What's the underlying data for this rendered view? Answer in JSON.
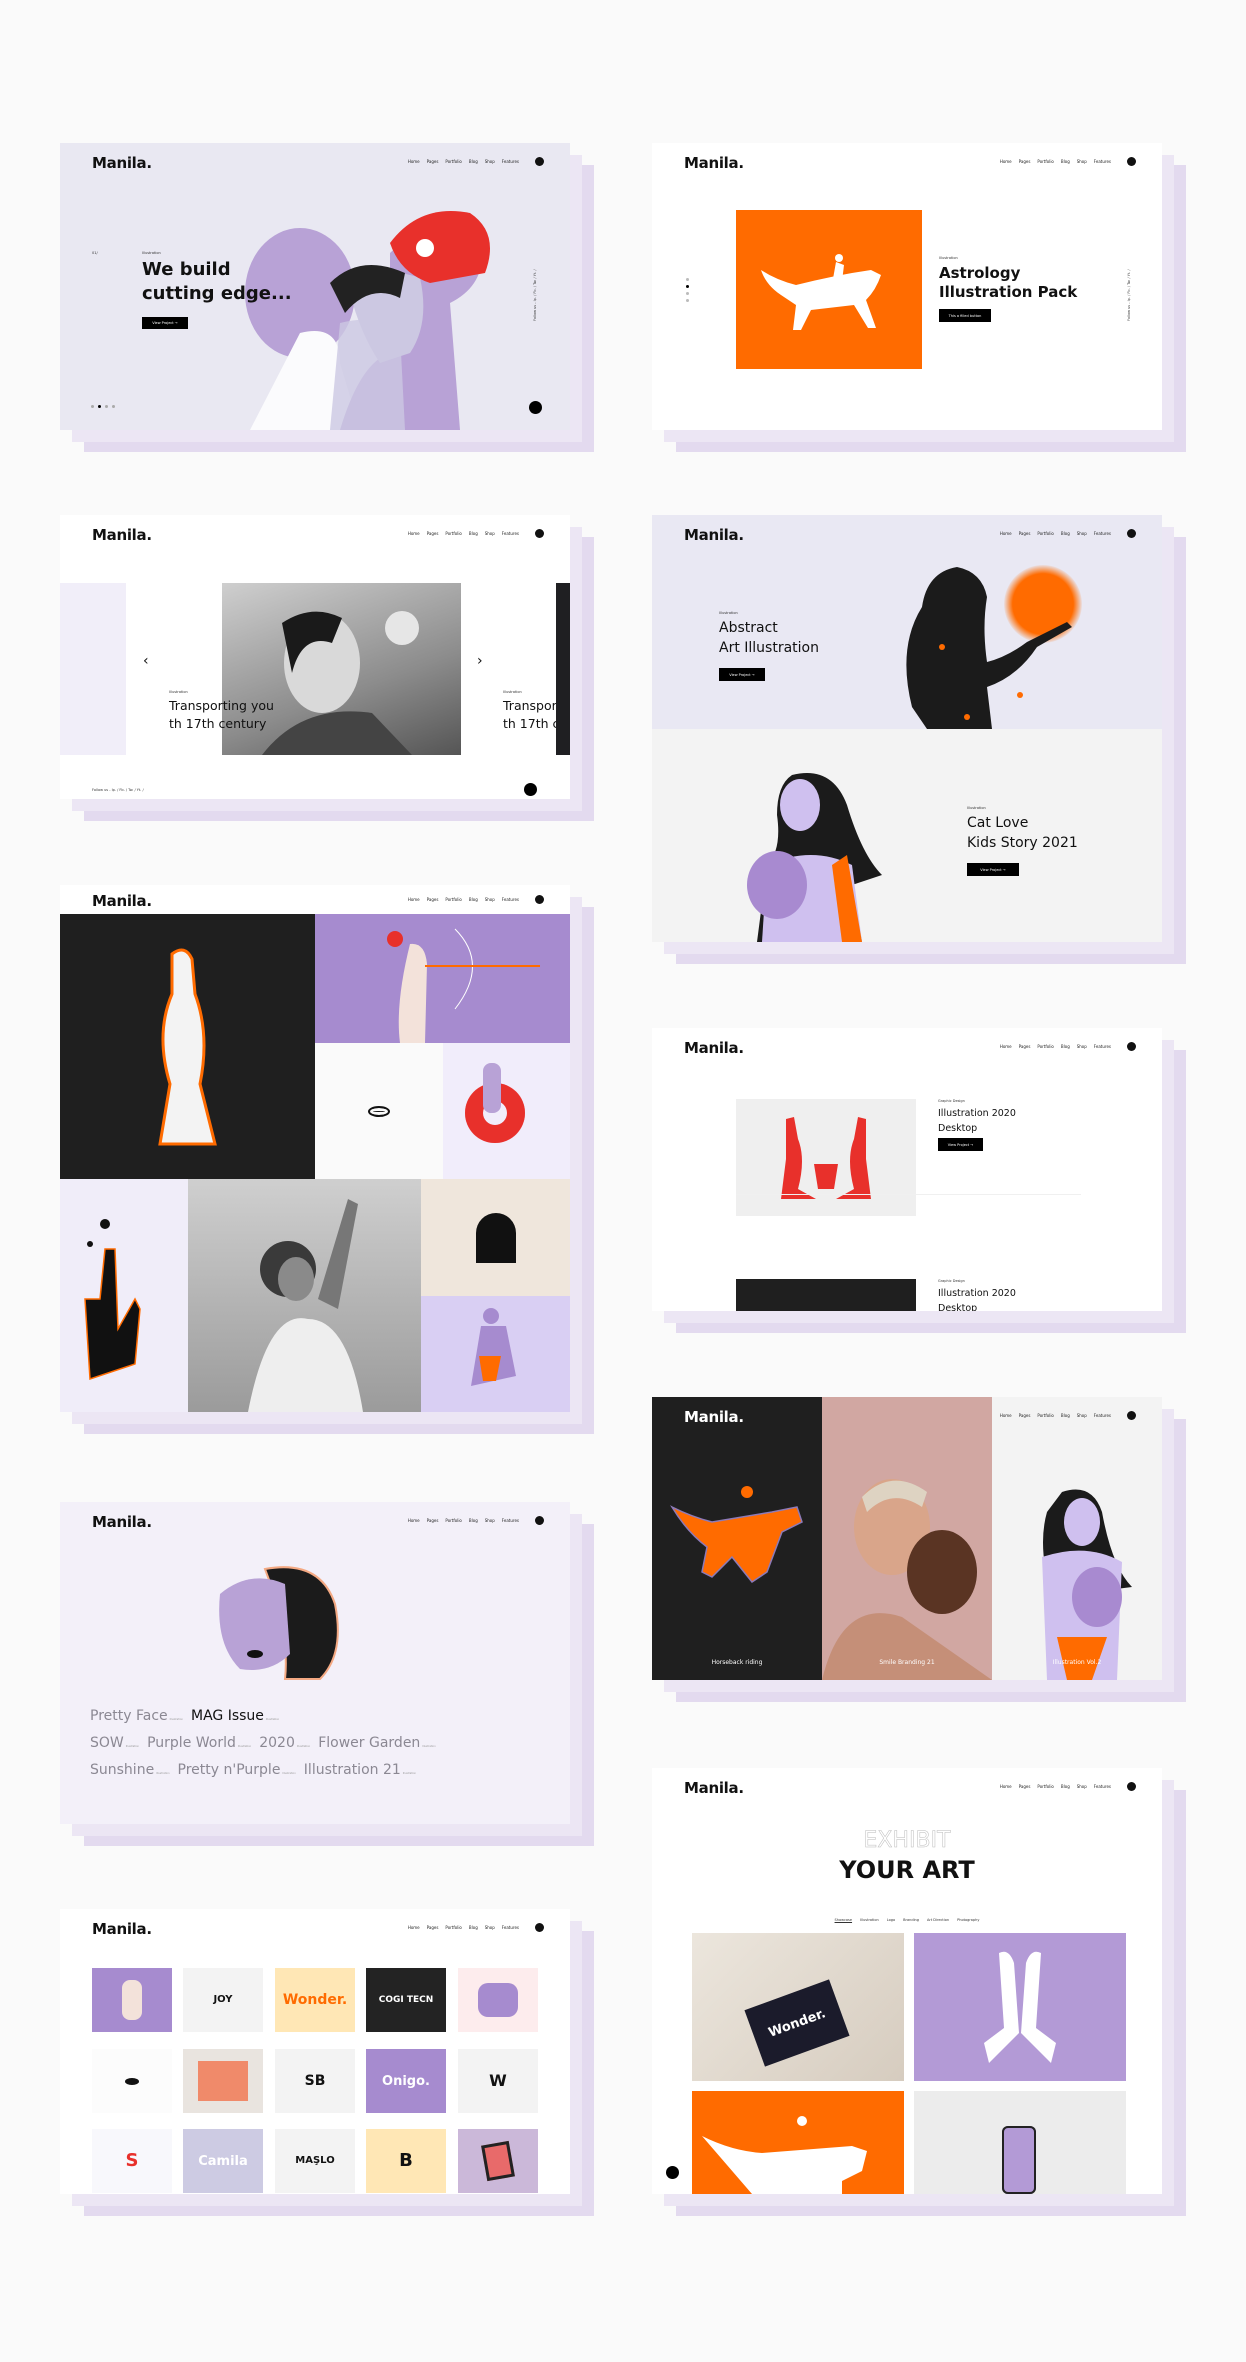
{
  "brand": "Manila.",
  "nav": [
    "Home",
    "Pages",
    "Portfolio",
    "Blog",
    "Shop",
    "Features"
  ],
  "colors": {
    "accent_orange": "#ff6b00",
    "purple": "#b39ad6",
    "lavender_bg": "#e9e8f2",
    "shadow": "#e3daef",
    "red": "#e8302b"
  },
  "hero1": {
    "index": "01/",
    "label": "Illustration",
    "title_1": "We build",
    "title_2": "cutting edge...",
    "button": "View Project →",
    "follow": "Follow us -  Ip. / Fb. / Tw. / Yt. /",
    "slide_active": 1,
    "slide_count": 4
  },
  "hero2": {
    "label": "Illustration",
    "title_1": "Astrology",
    "title_2": "Illustration Pack",
    "button": "This a filled button",
    "follow": "Follow us -  Ip. / Fb. / Tw. / Yt. /",
    "slide_active": 1,
    "slide_count": 4
  },
  "slider": {
    "label": "Illustration",
    "title_1": "Transporting you",
    "title_2": "th 17th century",
    "next_label": "Illustration",
    "next_title_1": "Transport",
    "next_title_2": "th 17th ce",
    "prev_icon": "chevron-left",
    "next_icon": "chevron-right",
    "follow": "Follow us -  Ip. / Fb. / Tw. / Yt. /"
  },
  "split": {
    "top": {
      "label": "Illustration",
      "title_1": "Abstract",
      "title_2": "Art Illustration",
      "button": "View Project →"
    },
    "bottom": {
      "label": "Illustration",
      "title_1": "Cat Love",
      "title_2": "Kids Story 2021",
      "button": "View Project →"
    }
  },
  "list": {
    "items": [
      {
        "label": "Graphic Design",
        "title_1": "Illustration 2020",
        "title_2": "Desktop",
        "button": "View Project →"
      },
      {
        "label": "Graphic Design",
        "title_1": "Illustration 2020",
        "title_2": "Desktop"
      }
    ]
  },
  "mag": {
    "rows": [
      [
        {
          "t": "Pretty Face",
          "s": "Illustration"
        },
        {
          "t": "MAG Issue",
          "s": "Illustration",
          "active": true
        }
      ],
      [
        {
          "t": "SOW",
          "s": "Illustration"
        },
        {
          "t": "Purple World",
          "s": "Illustration"
        },
        {
          "t": "2020",
          "s": "Illustration"
        },
        {
          "t": "Flower Garden",
          "s": "Illustration"
        }
      ],
      [
        {
          "t": "Sunshine",
          "s": "Illustration"
        },
        {
          "t": "Pretty n'Purple",
          "s": "Illustration"
        },
        {
          "t": "Illustration 21",
          "s": "Illustration"
        }
      ]
    ]
  },
  "columns": {
    "captions": [
      "Horseback riding",
      "Smile Branding 21",
      "Illustration Vol.2"
    ]
  },
  "logos": {
    "tiles": [
      "",
      "JOY",
      "Wonder.",
      "COGI TECN",
      "",
      "",
      "",
      "SB",
      "Onigo.",
      "W",
      "S",
      "Camila",
      "MAŞLO",
      "B",
      ""
    ]
  },
  "exhibit": {
    "outline": "EXHIBIT",
    "title": "YOUR ART",
    "filters": [
      "Showcase",
      "Illustration",
      "Logo",
      "Branding",
      "Art Direction",
      "Photography"
    ],
    "tile_text": "Wonder."
  }
}
